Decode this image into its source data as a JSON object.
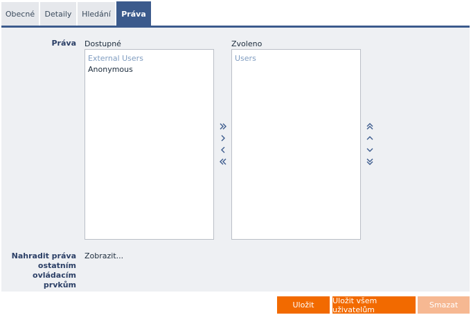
{
  "tabs": [
    {
      "label": "Obecné",
      "active": false
    },
    {
      "label": "Detaily",
      "active": false
    },
    {
      "label": "Hledání",
      "active": false
    },
    {
      "label": "Práva",
      "active": true
    }
  ],
  "rights": {
    "label": "Práva",
    "available_label": "Dostupné",
    "selected_label": "Zvoleno",
    "available_items": [
      {
        "text": "External Users",
        "kind": "group"
      },
      {
        "text": "Anonymous",
        "kind": "plain"
      }
    ],
    "selected_items": [
      {
        "text": "Users",
        "kind": "group"
      }
    ]
  },
  "transfer_icons": [
    "double-chevron-right-icon",
    "chevron-right-icon",
    "chevron-left-icon",
    "double-chevron-left-icon"
  ],
  "order_icons": [
    "double-chevron-up-icon",
    "chevron-up-icon",
    "chevron-down-icon",
    "double-chevron-down-icon"
  ],
  "replace": {
    "label_lines": [
      "Nahradit práva",
      "ostatním",
      "ovládacím",
      "prvkům"
    ],
    "link": "Zobrazit..."
  },
  "buttons": {
    "save": "Uložit",
    "save_all": "Uložit všem uživatelům",
    "delete": "Smazat"
  },
  "colors": {
    "accent": "#3b5a8c",
    "primary_button": "#f26a00",
    "disabled_button": "#f6b892",
    "group_item": "#7f9cc0"
  }
}
